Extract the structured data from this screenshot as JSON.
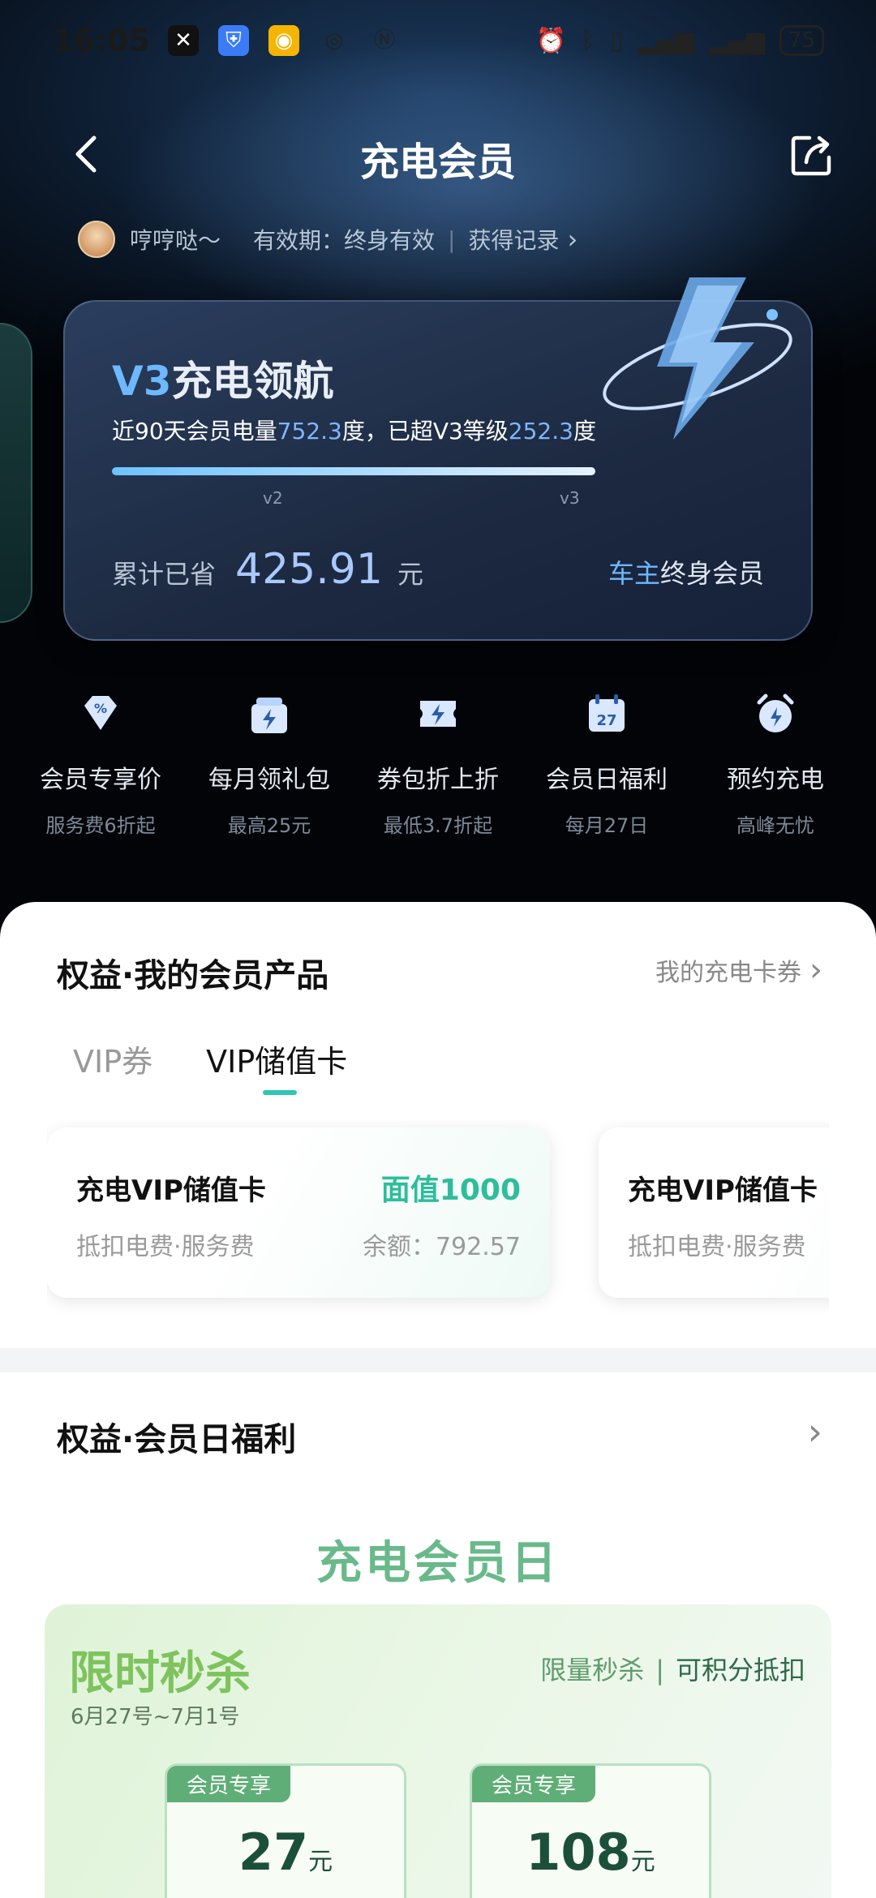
{
  "status_bar": {
    "time": "16:05",
    "battery": "75"
  },
  "header": {
    "title": "充电会员"
  },
  "user": {
    "name": "哼哼哒～",
    "validity": "有效期：终身有效",
    "records": "获得记录"
  },
  "vip_card": {
    "level_code": "V3",
    "level_name": "充电领航",
    "desc_prefix": "近90天会员电量",
    "desc_power": "752.3",
    "desc_middle": "度，已超V3等级",
    "desc_over": "252.3",
    "desc_suffix": "度",
    "progress": 1.0,
    "tick_left": "v2",
    "tick_right": "v3",
    "saved_label": "累计已省",
    "saved_amount": "425.91",
    "saved_unit": "元",
    "member_a": "车主",
    "member_b": "终身会员"
  },
  "perks": [
    {
      "icon": "percent-diamond-icon",
      "title": "会员专享价",
      "sub": "服务费6折起"
    },
    {
      "icon": "gift-icon",
      "title": "每月领礼包",
      "sub": "最高25元"
    },
    {
      "icon": "coupon-bolt-icon",
      "title": "券包折上折",
      "sub": "最低3.7折起"
    },
    {
      "icon": "calendar-icon",
      "title": "会员日福利",
      "sub": "每月27日"
    },
    {
      "icon": "alarm-clock-icon",
      "title": "预约充电",
      "sub": "高峰无忧"
    }
  ],
  "products": {
    "title": "权益·我的会员产品",
    "link": "我的充电卡券",
    "tabs": [
      "VIP券",
      "VIP储值卡"
    ],
    "active_tab": 1,
    "cards": [
      {
        "name": "充电VIP储值卡",
        "desc": "抵扣电费·服务费",
        "face_value": "面值1000",
        "balance": "余额：792.57"
      },
      {
        "name": "充电VIP储值卡",
        "desc": "抵扣电费·服务费"
      }
    ]
  },
  "member_day": {
    "title": "权益·会员日福利",
    "banner_title": "充电会员日",
    "promo_title": "限时秒杀",
    "promo_date": "6月27号~7月1号",
    "promo_tag_a": "限量秒杀",
    "promo_tag_sep": "|",
    "promo_tag_b": "可积分抵扣",
    "coupons": [
      {
        "label": "会员专享",
        "amount": "27",
        "unit": "元"
      },
      {
        "label": "会员专享",
        "amount": "108",
        "unit": "元"
      }
    ]
  }
}
